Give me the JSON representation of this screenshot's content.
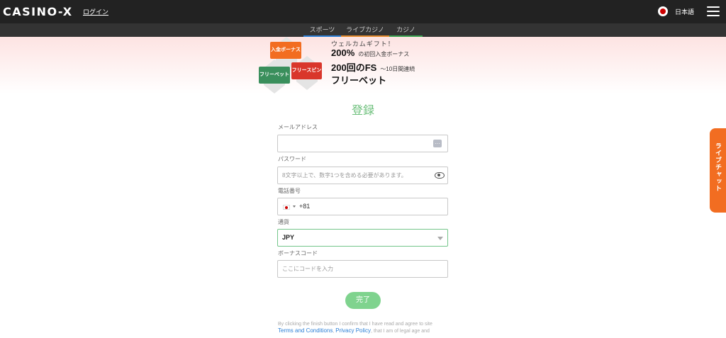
{
  "header": {
    "logo": "CASINO-X",
    "login_label": "ログイン",
    "language_label": "日本語"
  },
  "nav": {
    "tabs": [
      {
        "label": "スポーツ",
        "color": "#2b7fd6"
      },
      {
        "label": "ライブカジノ",
        "color": "#e38a2c"
      },
      {
        "label": "カジノ",
        "color": "#3aa351"
      }
    ]
  },
  "promo": {
    "badges": {
      "bonus": "入金ボーナス",
      "freebet": "フリーベット",
      "freespin": "フリースピン"
    },
    "welcome": "ウェルカムギフト！",
    "line1_big": "200%",
    "line1_small": "の初回入金ボーナス",
    "line2_big": "200回のFS",
    "line2_small": "～10日間連続",
    "line3_big": "フリーベット"
  },
  "form": {
    "title": "登録",
    "email": {
      "label": "メールアドレス",
      "value": "",
      "placeholder": ""
    },
    "password": {
      "label": "パスワード",
      "placeholder": "8文字以上で、数字1つを含める必要があります。"
    },
    "phone": {
      "label": "電話番号",
      "country_code": "+81"
    },
    "currency": {
      "label": "通貨",
      "selected": "JPY"
    },
    "bonus_code": {
      "label": "ボーナスコード",
      "placeholder": "ここにコードを入力"
    },
    "submit_label": "完了"
  },
  "terms": {
    "line1": "By clicking the finish button I confirm that I have read and agree to site",
    "terms_link": "Terms and Conditions",
    "privacy_link": "Privacy Policy",
    "line2_rest": ", that I am of legal age and"
  },
  "live_chat": {
    "label": "ライブチャット"
  },
  "colors": {
    "accent_green": "#6bbf7a",
    "chat_orange": "#f26d21",
    "header_bg": "#222222"
  }
}
